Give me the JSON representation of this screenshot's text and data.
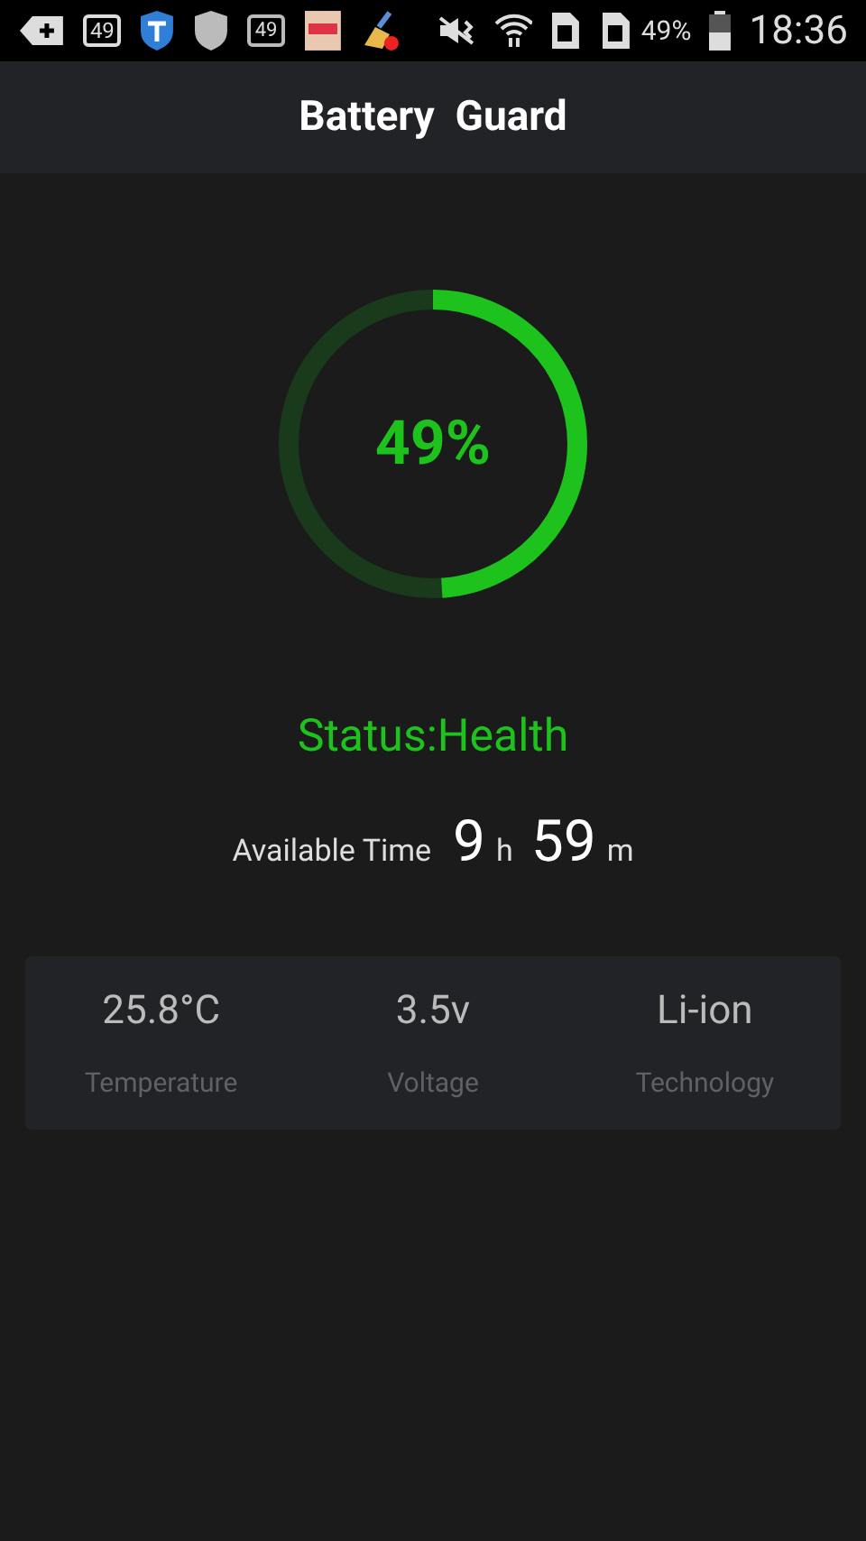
{
  "status_bar": {
    "notification_counts": [
      "49",
      "49"
    ],
    "battery_percent": "49%",
    "time": "18:36"
  },
  "header": {
    "title": "Battery  Guard"
  },
  "gauge": {
    "level": 0.49,
    "label": "49%"
  },
  "status": {
    "text": "Status:Health"
  },
  "available_time": {
    "label": "Available Time",
    "hours": "9",
    "hours_unit": "h",
    "minutes": "59",
    "minutes_unit": "m"
  },
  "stats": [
    {
      "value": "25.8°C",
      "label": "Temperature"
    },
    {
      "value": "3.5v",
      "label": "Voltage"
    },
    {
      "value": "Li-ion",
      "label": "Technology"
    }
  ]
}
